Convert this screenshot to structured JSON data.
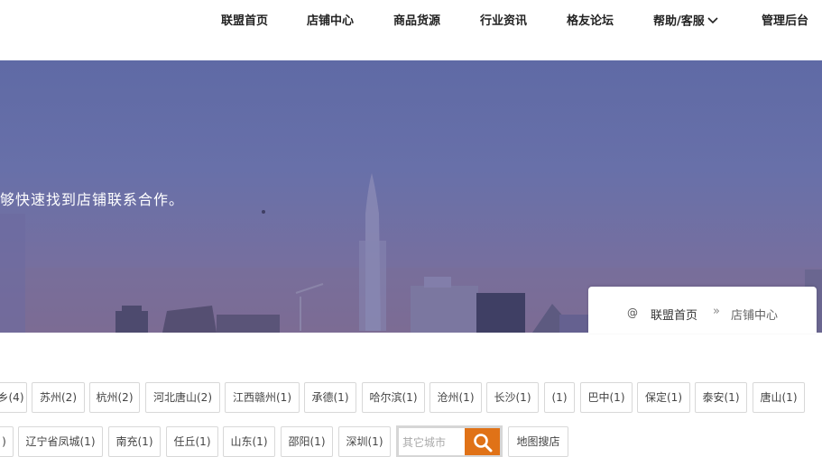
{
  "nav": {
    "items": [
      "联盟首页",
      "店铺中心",
      "商品货源",
      "行业资讯",
      "格友论坛",
      "帮助/客服",
      "管理后台"
    ]
  },
  "banner": {
    "text": "够快速找到店铺联系合作。"
  },
  "breadcrumb": {
    "at": "@",
    "home": "联盟首页",
    "sep": "»",
    "current": "店铺中心"
  },
  "cities": {
    "row1": [
      "乡(4)",
      "苏州(2)",
      "杭州(2)",
      "河北唐山(2)",
      "江西赣州(1)",
      "承德(1)",
      "哈尔滨(1)",
      "沧州(1)",
      "长沙(1)",
      "(1)",
      "巴中(1)",
      "保定(1)",
      "泰安(1)",
      "唐山(1)"
    ],
    "row2": [
      ")",
      "辽宁省凤城(1)",
      "南充(1)",
      "任丘(1)",
      "山东(1)",
      "邵阳(1)",
      "深圳(1)"
    ]
  },
  "search": {
    "placeholder": "其它城市",
    "map_label": "地图搜店"
  },
  "colors": {
    "accent": "#e07217",
    "banner": "#6870a9"
  }
}
